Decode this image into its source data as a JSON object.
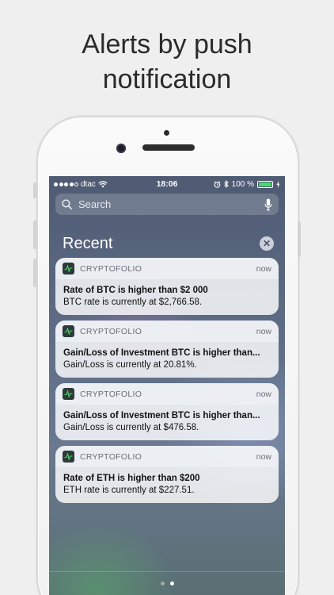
{
  "headline": {
    "line1": "Alerts by push",
    "line2": "notification"
  },
  "status_bar": {
    "carrier": "dtac",
    "time": "18:06",
    "battery_percent": "100 %",
    "signal_bars_filled": 4,
    "battery_level": 1.0,
    "battery_color": "#4cd964"
  },
  "search": {
    "placeholder": "Search"
  },
  "section": {
    "title": "Recent",
    "clear_glyph": "✕"
  },
  "notifications": [
    {
      "app": "CRYPTOFOLIO",
      "time": "now",
      "title": "Rate of BTC is higher than $2 000",
      "body": "BTC rate is currently at $2,766.58."
    },
    {
      "app": "CRYPTOFOLIO",
      "time": "now",
      "title": "Gain/Loss of Investment BTC is higher than...",
      "body": "Gain/Loss is currently at 20.81%."
    },
    {
      "app": "CRYPTOFOLIO",
      "time": "now",
      "title": "Gain/Loss of Investment BTC is higher than...",
      "body": "Gain/Loss is currently at $476.58."
    },
    {
      "app": "CRYPTOFOLIO",
      "time": "now",
      "title": "Rate of ETH is higher than $200",
      "body": "ETH rate is currently at $227.51."
    }
  ],
  "pager": {
    "pages": 2,
    "active": 1
  },
  "icons": [
    "wifi-icon",
    "alarm-icon",
    "bluetooth-icon",
    "battery-icon",
    "charging-icon",
    "search-icon",
    "microphone-icon",
    "clear-icon",
    "app-chart-icon"
  ]
}
